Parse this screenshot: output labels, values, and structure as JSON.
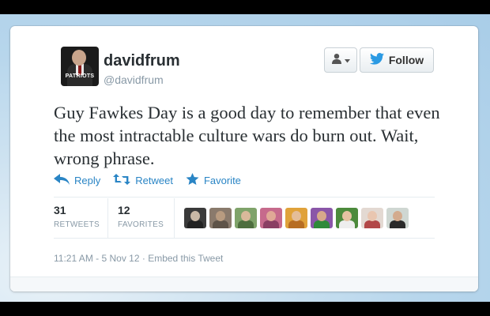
{
  "tweet": {
    "name": "davidfrum",
    "handle": "@davidfrum",
    "avatar_text": "PATRIOTS",
    "text": "Guy Fawkes Day is a good day to remember that even the most intractable culture wars do burn out. Wait, wrong phrase.",
    "follow_label": "Follow",
    "actions": {
      "reply": "Reply",
      "retweet": "Retweet",
      "favorite": "Favorite"
    },
    "stats": {
      "retweets_count": "31",
      "retweets_label": "RETWEETS",
      "favorites_count": "12",
      "favorites_label": "FAVORITES"
    },
    "timestamp": "11:21 AM - 5 Nov 12",
    "embed_label": "Embed this Tweet",
    "separator": " · "
  },
  "icons": {
    "user_menu": "person-icon",
    "twitter_bird": "twitter-bird-icon",
    "reply": "reply-arrow-icon",
    "retweet": "retweet-icon",
    "favorite": "star-icon"
  },
  "colors": {
    "accent": "#2a85c5",
    "twitter_blue": "#2b9ae3",
    "text": "#292f33",
    "muted": "#8899a6"
  },
  "favoriter_faces": [
    {
      "skin": "#c9b8a6",
      "bg": "#3a3a3a",
      "shirt": "#222222"
    },
    {
      "skin": "#b89b80",
      "bg": "#8a7a6c",
      "shirt": "#5e5348"
    },
    {
      "skin": "#d9b99a",
      "bg": "#7fa36a",
      "shirt": "#4e6e3e"
    },
    {
      "skin": "#e0a896",
      "bg": "#c66a8c",
      "shirt": "#8a3f63"
    },
    {
      "skin": "#e4bd98",
      "bg": "#e0a23a",
      "shirt": "#b76d22"
    },
    {
      "skin": "#d8a98a",
      "bg": "#8a56a8",
      "shirt": "#2f8a3a"
    },
    {
      "skin": "#e6c2a2",
      "bg": "#4c8a3c",
      "shirt": "#eeeeee"
    },
    {
      "skin": "#e9c6b0",
      "bg": "#e3d9d2",
      "shirt": "#b24848"
    },
    {
      "skin": "#d3ab8e",
      "bg": "#cfd7d2",
      "shirt": "#2a2a2a"
    }
  ]
}
